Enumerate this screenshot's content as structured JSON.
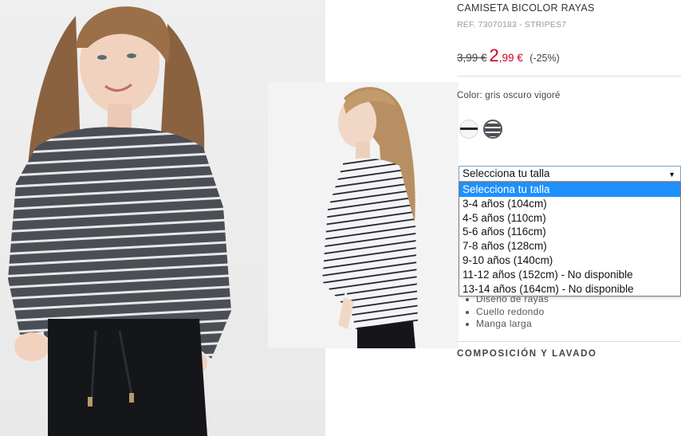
{
  "product": {
    "title": "CAMISETA BICOLOR RAYAS",
    "ref": "REF. 73070183 - STRIPES7",
    "price_old": "3,99 €",
    "price_new_int": "2",
    "price_new_dec": ",99 €",
    "discount": "(-25%)",
    "color_label": "Color: gris oscuro vigoré",
    "swatches": [
      "striped-white-swatch",
      "striped-dark-grey-swatch"
    ]
  },
  "size_select": {
    "value": "Selecciona tu talla",
    "arrow": "▼",
    "options": [
      "Selecciona tu talla",
      "3-4 años (104cm)",
      "4-5 años (110cm)",
      "5-6 años (116cm)",
      "7-8 años (128cm)",
      "9-10 años (140cm)",
      "11-12 años (152cm) - No disponible",
      "13-14 años (164cm) - No disponible"
    ],
    "selected_index": 0
  },
  "description": {
    "items": [
      "Diseño de rayas",
      "Cuello redondo",
      "Manga larga"
    ]
  },
  "sections": {
    "composition": "COMPOSICIÓN Y LAVADO"
  },
  "colors": {
    "price_red": "#d0021b",
    "option_highlight": "#1e90ff",
    "shirt_dark": "#4a4d54",
    "shirt_light": "#f4f4f4"
  }
}
